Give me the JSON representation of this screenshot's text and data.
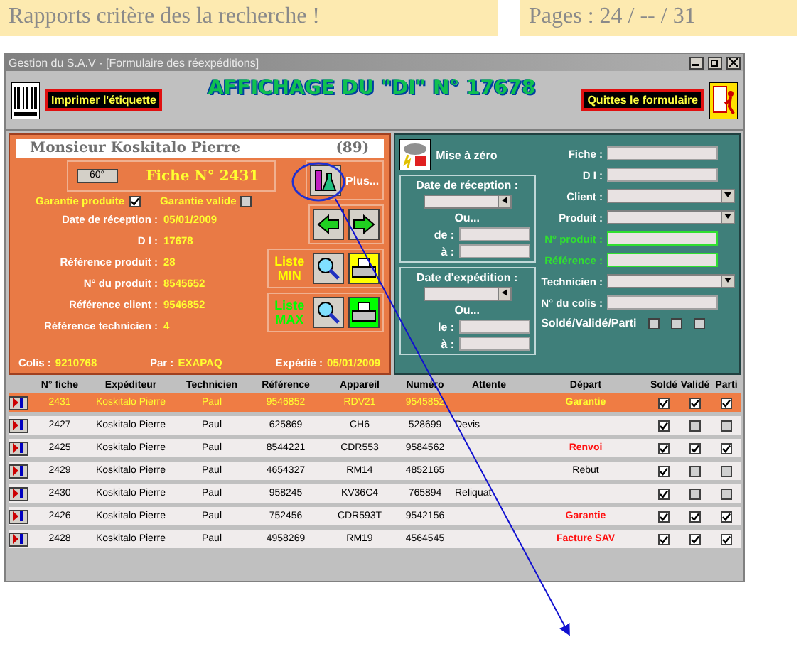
{
  "page_header": {
    "title": "Rapports critère des la recherche !",
    "pages": "Pages : 24 / -- / 31"
  },
  "window": {
    "title": "Gestion du S.A.V - [Formulaire des réexpéditions]"
  },
  "toolbar": {
    "print_button": "Imprimer  l'étiquette",
    "heading": "AFFICHAGE DU \"DI\" N° 17678",
    "quit_button": "Quittes le formulaire"
  },
  "record": {
    "client": "Monsieur  Koskitalo  Pierre",
    "count": "(89)",
    "small_button": "60°",
    "fiche": "Fiche N° 2431",
    "more_button": "Plus...",
    "checks": [
      {
        "label": "Garantie produite",
        "checked": true
      },
      {
        "label": "Garantie valide",
        "checked": false
      }
    ],
    "fields": [
      {
        "label": "Date de réception :",
        "value": "05/01/2009"
      },
      {
        "label": "D I :",
        "value": "17678"
      },
      {
        "label": "Référence produit :",
        "value": "28"
      },
      {
        "label": "N° du produit :",
        "value": "8545652"
      },
      {
        "label": "Référence client :",
        "value": "9546852"
      },
      {
        "label": "Référence technicien :",
        "value": "4"
      }
    ],
    "lists": [
      {
        "label": "Liste MIN",
        "color": "#ffff00"
      },
      {
        "label": "Liste MAX",
        "color": "#00ff00"
      }
    ],
    "footer": [
      {
        "label": "Colis :",
        "value": "9210768"
      },
      {
        "label": "Par :",
        "value": "EXAPAQ"
      },
      {
        "label": "Expédié :",
        "value": "05/01/2009"
      }
    ]
  },
  "filter": {
    "reset_button": "Mise à zéro",
    "date_groups": [
      {
        "title": "Date de réception :",
        "or": "Ou...",
        "from": "de :",
        "to": "à :"
      },
      {
        "title": "Date d'expédition :",
        "or": "Ou...",
        "from": "le :",
        "to": "à :"
      }
    ],
    "fields": [
      {
        "label": "Fiche :",
        "kind": "text",
        "highlight": false
      },
      {
        "label": "D I :",
        "kind": "text",
        "highlight": false
      },
      {
        "label": "Client :",
        "kind": "combo",
        "highlight": false
      },
      {
        "label": "Produit :",
        "kind": "combo",
        "highlight": false
      },
      {
        "label": "N° produit :",
        "kind": "text",
        "highlight": true
      },
      {
        "label": "Référence :",
        "kind": "text",
        "highlight": true
      },
      {
        "label": "Technicien :",
        "kind": "combo",
        "highlight": false
      },
      {
        "label": "N° du colis :",
        "kind": "text",
        "highlight": false
      }
    ],
    "status_label": "Soldé/Validé/Parti",
    "status_checks": [
      {
        "checked": false
      },
      {
        "checked": false
      },
      {
        "checked": false
      }
    ]
  },
  "table": {
    "columns": [
      "N° fiche",
      "Expéditeur",
      "Technicien",
      "Référence",
      "Appareil",
      "Numéro",
      "Attente",
      "Départ",
      "Soldé",
      "Validé",
      "Parti"
    ],
    "rows": [
      {
        "selected": true,
        "fiche": "2431",
        "expediteur": "Koskitalo  Pierre",
        "technicien": "Paul",
        "reference": "9546852",
        "appareil": "RDV21",
        "numero": "9545852",
        "attente": "",
        "depart": "Garantie",
        "alert": true,
        "solde": true,
        "valide": true,
        "parti": true
      },
      {
        "selected": false,
        "fiche": "2427",
        "expediteur": "Koskitalo  Pierre",
        "technicien": "Paul",
        "reference": "625869",
        "appareil": "CH6",
        "numero": "528699",
        "attente": "Devis",
        "depart": "",
        "solde": true,
        "valide": false,
        "parti": false
      },
      {
        "selected": false,
        "fiche": "2425",
        "expediteur": "Koskitalo  Pierre",
        "technicien": "Paul",
        "reference": "8544221",
        "appareil": "CDR553",
        "numero": "9584562",
        "attente": "",
        "depart": "Renvoi",
        "alert": true,
        "solde": true,
        "valide": true,
        "parti": true
      },
      {
        "selected": false,
        "fiche": "2429",
        "expediteur": "Koskitalo  Pierre",
        "technicien": "Paul",
        "reference": "4654327",
        "appareil": "RM14",
        "numero": "4852165",
        "attente": "",
        "depart": "Rebut",
        "alert": false,
        "solde": true,
        "valide": false,
        "parti": false
      },
      {
        "selected": false,
        "fiche": "2430",
        "expediteur": "Koskitalo  Pierre",
        "technicien": "Paul",
        "reference": "958245",
        "appareil": "KV36C4",
        "numero": "765894",
        "attente": "Reliquat",
        "depart": "",
        "solde": true,
        "valide": false,
        "parti": false
      },
      {
        "selected": false,
        "fiche": "2426",
        "expediteur": "Koskitalo  Pierre",
        "technicien": "Paul",
        "reference": "752456",
        "appareil": "CDR593T",
        "numero": "9542156",
        "attente": "",
        "depart": "Garantie",
        "alert": true,
        "solde": true,
        "valide": true,
        "parti": true
      },
      {
        "selected": false,
        "fiche": "2428",
        "expediteur": "Koskitalo  Pierre",
        "technicien": "Paul",
        "reference": "4958269",
        "appareil": "RM19",
        "numero": "4564545",
        "attente": "",
        "depart": "Facture SAV",
        "alert": true,
        "solde": true,
        "valide": true,
        "parti": true
      }
    ]
  }
}
